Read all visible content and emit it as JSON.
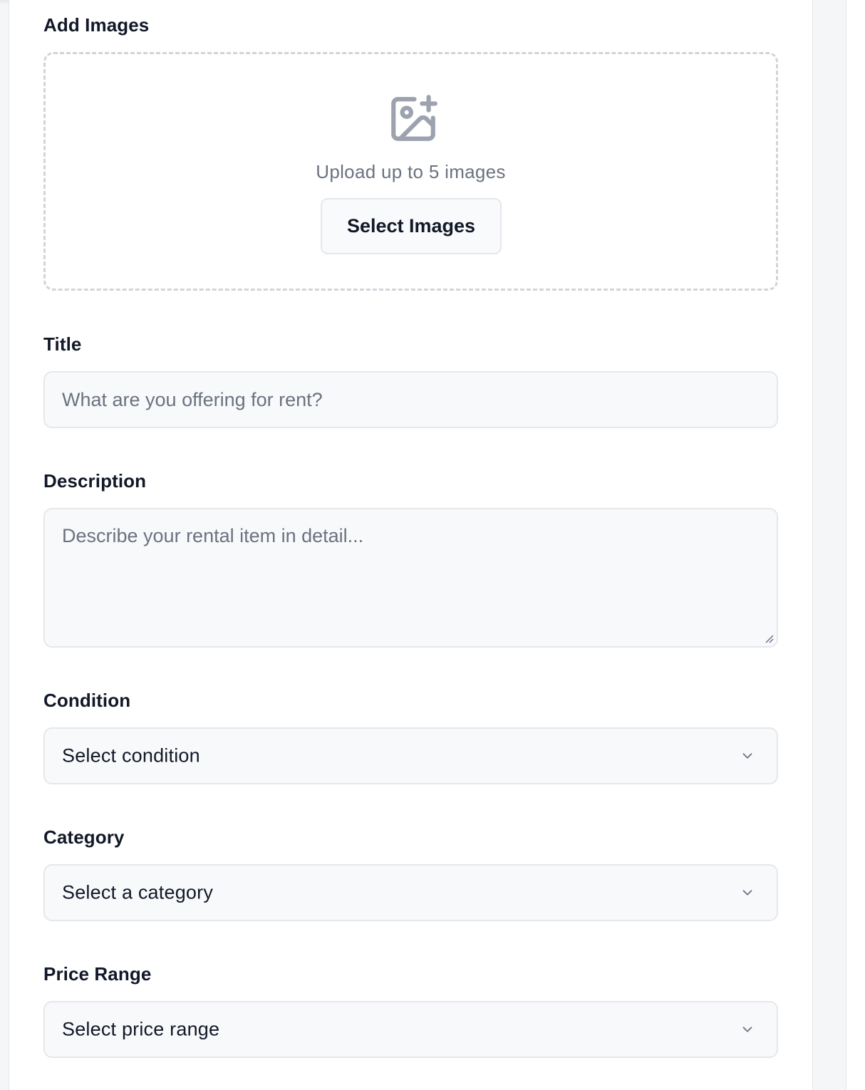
{
  "form": {
    "images": {
      "label": "Add Images",
      "icon": "image-plus-icon",
      "hint": "Upload up to 5 images",
      "button_label": "Select Images"
    },
    "title": {
      "label": "Title",
      "placeholder": "What are you offering for rent?",
      "value": ""
    },
    "description": {
      "label": "Description",
      "placeholder": "Describe your rental item in detail...",
      "value": ""
    },
    "condition": {
      "label": "Condition",
      "selected": "Select condition",
      "icon": "chevron-down-icon"
    },
    "category": {
      "label": "Category",
      "selected": "Select a category",
      "icon": "chevron-down-icon"
    },
    "price_range": {
      "label": "Price Range",
      "selected": "Select price range",
      "icon": "chevron-down-icon"
    }
  },
  "colors": {
    "text": "#111827",
    "muted": "#6b7280",
    "border": "#e5e7eb",
    "field_bg": "#f8f9fb",
    "icon": "#9ca3af"
  }
}
